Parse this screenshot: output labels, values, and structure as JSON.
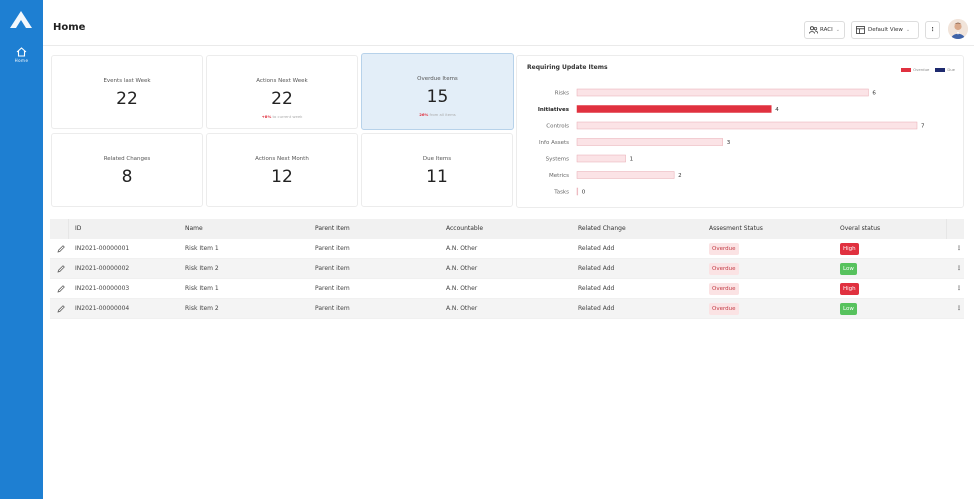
{
  "app": {
    "title": "Home"
  },
  "rail": {
    "home_label": "Home"
  },
  "header": {
    "raci_label": "RACI",
    "view_label": "Default View",
    "kebab": "⋮"
  },
  "cards": [
    {
      "title": "Events last Week",
      "value": "22",
      "sub": ""
    },
    {
      "title": "Actions Next Week",
      "value": "22",
      "sub_highlight": "+8%",
      "sub": " to current week"
    },
    {
      "title": "Overdue Items",
      "value": "15",
      "sub_highlight": "26%",
      "sub": " from all items",
      "selected": true
    },
    {
      "title": "Related Changes",
      "value": "8",
      "sub": ""
    },
    {
      "title": "Actions Next Month",
      "value": "12",
      "sub": ""
    },
    {
      "title": "Due Items",
      "value": "11",
      "sub": ""
    }
  ],
  "chart_data": {
    "type": "bar",
    "title": "Requiring Update Items",
    "orientation": "horizontal",
    "categories": [
      "Risks",
      "Initiatives",
      "Controls",
      "Info Assets",
      "Systems",
      "Metrics",
      "Tasks"
    ],
    "series": [
      {
        "name": "Overdue",
        "values": [
          6,
          4,
          7,
          3,
          1,
          2,
          0
        ]
      }
    ],
    "highlighted_category": "Initiatives",
    "legend": [
      "Overdue",
      "Due"
    ],
    "legend_position": "top-right",
    "xlim": [
      0,
      7
    ],
    "colors": {
      "bar": "#fbe3e6",
      "bar_border": "#e8aab2",
      "highlight": "#e0313f",
      "overdue_swatch": "#e0313f",
      "due_swatch": "#1e2a6e"
    }
  },
  "table": {
    "columns": [
      "ID",
      "Name",
      "Parent Item",
      "Accountable",
      "Related Change",
      "Assesment Status",
      "Overal status"
    ],
    "rows": [
      {
        "id": "IN2021-00000001",
        "name": "Risk Item 1",
        "parent": "Parent item",
        "accountable": "A.N. Other",
        "change": "Related Add",
        "assessment": "Overdue",
        "status": "High"
      },
      {
        "id": "IN2021-00000002",
        "name": "Risk Item 2",
        "parent": "Parent item",
        "accountable": "A.N. Other",
        "change": "Related Add",
        "assessment": "Overdue",
        "status": "Low"
      },
      {
        "id": "IN2021-00000003",
        "name": "Risk Item 1",
        "parent": "Parent item",
        "accountable": "A.N. Other",
        "change": "Related Add",
        "assessment": "Overdue",
        "status": "High"
      },
      {
        "id": "IN2021-00000004",
        "name": "Risk Item 2",
        "parent": "Parent item",
        "accountable": "A.N. Other",
        "change": "Related Add",
        "assessment": "Overdue",
        "status": "Low"
      }
    ]
  },
  "colors": {
    "accent": "#1e7fd2",
    "high": "#e0313f",
    "low": "#57c25d"
  }
}
